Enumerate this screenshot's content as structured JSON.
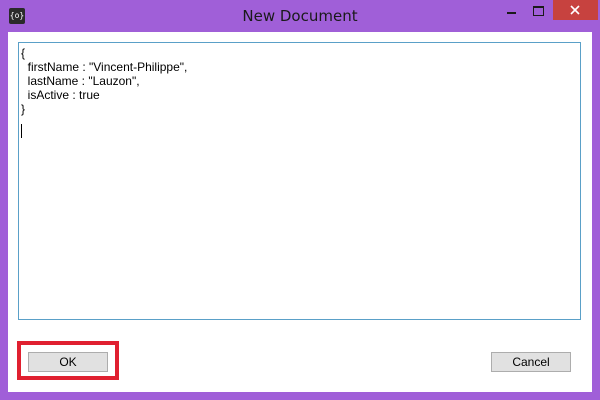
{
  "window": {
    "title": "New Document",
    "app_icon_glyph": "{o}",
    "controls": {
      "minimize_icon": "minimize-icon",
      "maximize_icon": "maximize-icon",
      "close_icon": "close-icon"
    },
    "accent_color": "#a05fd8",
    "close_color": "#c7423f"
  },
  "editor": {
    "content": "{\n  firstName : \"Vincent-Philippe\",\n  lastName : \"Lauzon\",\n  isActive : true\n}"
  },
  "buttons": {
    "ok_label": "OK",
    "cancel_label": "Cancel"
  },
  "annotation": {
    "highlight_color": "#e02030"
  }
}
